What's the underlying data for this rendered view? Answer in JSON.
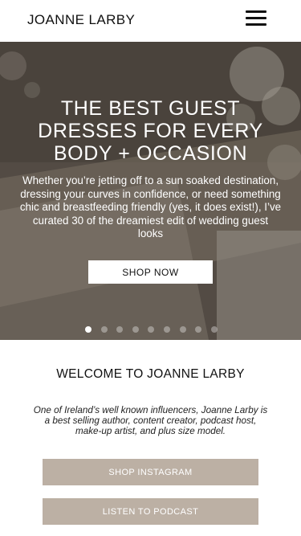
{
  "header": {
    "brand": "JOANNE LARBY",
    "menu_icon": "hamburger-menu-icon"
  },
  "hero": {
    "title": "THE BEST GUEST DRESSES FOR EVERY BODY + OCCASION",
    "text": "Whether you’re jetting off to a sun soaked destination, dressing your curves in confidence, or need something chic and breastfeeding friendly (yes, it does exist!), I’ve curated 30 of the dreamiest edit of wedding guest looks",
    "cta_label": "SHOP NOW",
    "slide_count": 9,
    "active_slide": 1
  },
  "welcome": {
    "title": "WELCOME TO JOANNE LARBY",
    "text": "One of Ireland’s well known influencers, Joanne Larby is a best selling author, content creator, podcast host, make-up artist, and plus size model."
  },
  "buttons": {
    "instagram_label": "SHOP INSTAGRAM",
    "podcast_label": "LISTEN TO PODCAST"
  },
  "colors": {
    "cta_background": "#bcb0a4",
    "text": "#111111",
    "white": "#ffffff"
  }
}
